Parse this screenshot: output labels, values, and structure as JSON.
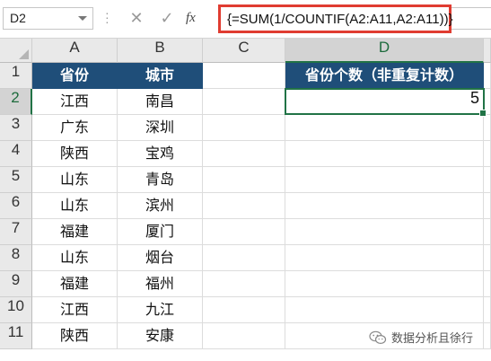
{
  "name_box": {
    "value": "D2"
  },
  "formula_bar": {
    "cancel_icon": "close-icon",
    "enter_icon": "checkmark-icon",
    "fx_label": "fx",
    "formula": "{=SUM(1/COUNTIF(A2:A11,A2:A11))}"
  },
  "columns": [
    "A",
    "B",
    "C",
    "D"
  ],
  "rows": [
    "1",
    "2",
    "3",
    "4",
    "5",
    "6",
    "7",
    "8",
    "9",
    "10",
    "11"
  ],
  "headers": {
    "a": "省份",
    "b": "城市",
    "d": "省份个数（非重复计数）"
  },
  "data": [
    {
      "province": "江西",
      "city": "南昌"
    },
    {
      "province": "广东",
      "city": "深圳"
    },
    {
      "province": "陕西",
      "city": "宝鸡"
    },
    {
      "province": "山东",
      "city": "青岛"
    },
    {
      "province": "山东",
      "city": "滨州"
    },
    {
      "province": "福建",
      "city": "厦门"
    },
    {
      "province": "山东",
      "city": "烟台"
    },
    {
      "province": "福建",
      "city": "福州"
    },
    {
      "province": "江西",
      "city": "九江"
    },
    {
      "province": "陕西",
      "city": "安康"
    }
  ],
  "result": "5",
  "selection": {
    "column": "D",
    "row": "2"
  },
  "colors": {
    "header_fill": "#1f4e79",
    "selection": "#217346",
    "formula_highlight": "#e03c31"
  },
  "watermark": {
    "text": "数据分析且徐行"
  }
}
